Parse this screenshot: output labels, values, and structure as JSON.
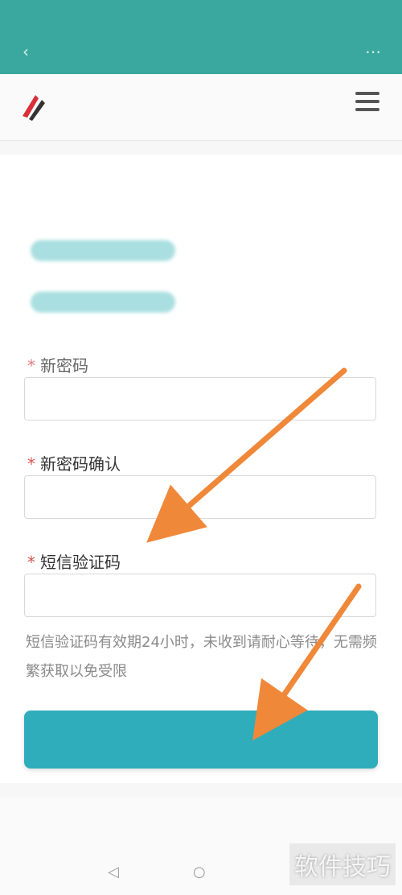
{
  "status_bar": {
    "left_text": "",
    "right_text": ""
  },
  "header": {
    "logo_text": "",
    "logo_icon": "brand-logo-icon",
    "menu_icon": "hamburger-icon"
  },
  "form": {
    "hint_text": "",
    "pill_after_text": "",
    "fields": [
      {
        "label": "新密码",
        "value": ""
      },
      {
        "label": "新密码确认",
        "value": ""
      },
      {
        "label": "短信验证码",
        "value": ""
      }
    ],
    "note": "短信验证码有效期24小时，未收到请耐心等待，无需频繁获取以免受限",
    "submit_label": ""
  },
  "footer": {
    "links": [
      "",
      "",
      ""
    ]
  },
  "watermark": "软件技巧",
  "colors": {
    "app_bar": "#3aa89e",
    "submit": "#2fadbb",
    "required_star": "#d9534f",
    "arrow": "#f0883a"
  }
}
